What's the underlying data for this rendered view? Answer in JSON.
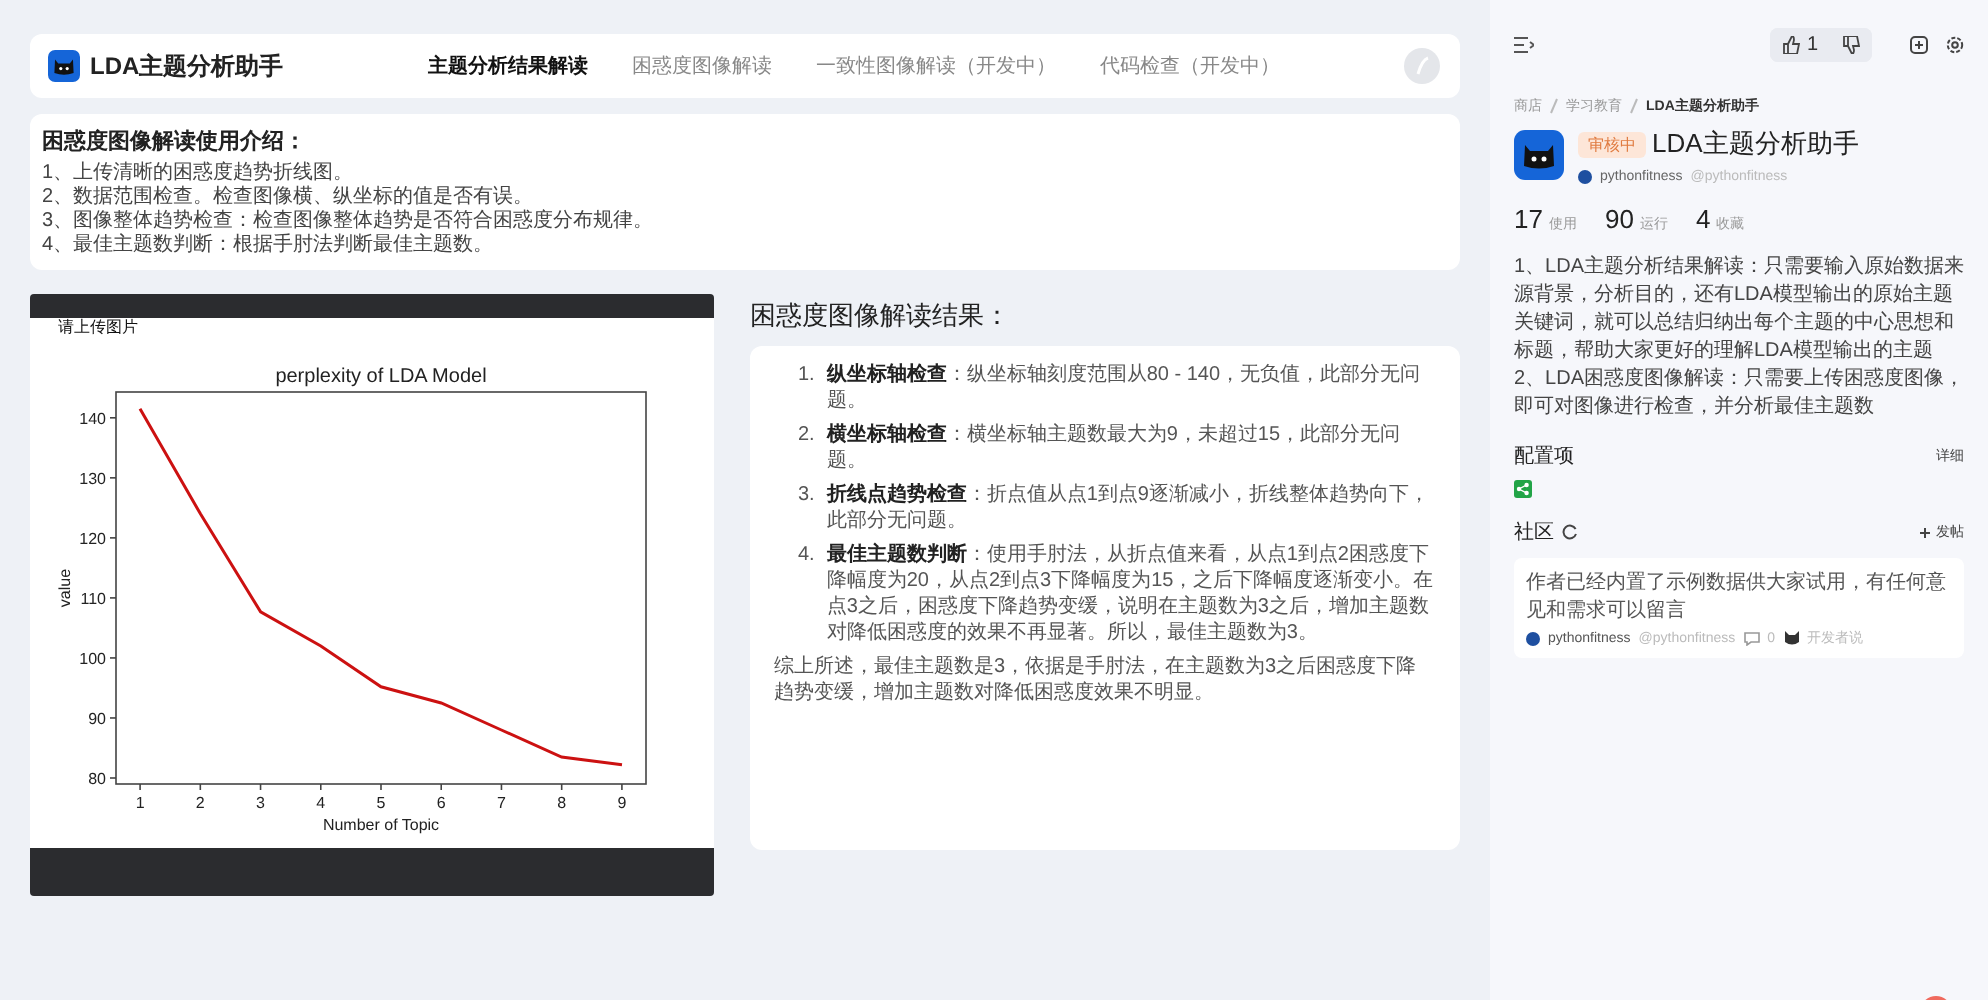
{
  "app": {
    "name": "LDA主题分析助手"
  },
  "nav_tabs": [
    {
      "label": "主题分析结果解读",
      "selected": true
    },
    {
      "label": "困惑度图像解读",
      "selected": false
    },
    {
      "label": "一致性图像解读（开发中）",
      "selected": false
    },
    {
      "label": "代码检查（开发中）",
      "selected": false
    }
  ],
  "intro": {
    "title": "困惑度图像解读使用介绍：",
    "items": [
      "1、上传清晰的困惑度趋势折线图。",
      "2、数据范围检查。检查图像横、纵坐标的值是否有误。",
      "3、图像整体趋势检查：检查图像整体趋势是否符合困惑度分布规律。",
      "4、最佳主题数判断：根据手肘法判断最佳主题数。"
    ]
  },
  "upload": {
    "label": "请上传图片",
    "chart_data": {
      "type": "line",
      "title": "perplexity of LDA Model",
      "xlabel": "Number of Topic",
      "ylabel": "value",
      "x": [
        1,
        2,
        3,
        4,
        5,
        6,
        7,
        8,
        9
      ],
      "series": [
        {
          "color": "#cc1111",
          "values": [
            141.5,
            124,
            107.7,
            102,
            95.2,
            92.5,
            88,
            83.5,
            82.2
          ]
        }
      ],
      "xlim": [
        0.6,
        9.4
      ],
      "ylim": [
        79,
        144.3
      ],
      "xticks": [
        1,
        2,
        3,
        4,
        5,
        6,
        7,
        8,
        9
      ],
      "yticks": [
        80,
        90,
        100,
        110,
        120,
        130,
        140
      ]
    }
  },
  "result": {
    "title": "困惑度图像解读结果：",
    "items": [
      {
        "number": "1.",
        "text": "**纵坐标轴检查**：纵坐标轴刻度范围从80 - 140，无负值，此部分无问题。"
      },
      {
        "number": "2.",
        "text": "**横坐标轴检查**：横坐标轴主题数最大为9，未超过15，此部分无问题。"
      },
      {
        "number": "3.",
        "text": "**折线点趋势检查**：折点值从点1到点9逐渐减小，折线整体趋势向下，此部分无问题。"
      },
      {
        "number": "4.",
        "text": "**最佳主题数判断**：使用手肘法，从折点值来看，从点1到点2困惑度下降幅度为20，从点2到点3下降幅度为15，之后下降幅度逐渐变小。在点3之后，困惑度下降趋势变缓，说明在主题数为3之后，增加主题数对降低困惑度的效果不再显著。所以，最佳主题数为3。"
      }
    ],
    "summary": "综上所述，最佳主题数是3，依据是手肘法，在主题数为3之后困惑度下降趋势变缓，增加主题数对降低困惑度效果不明显。"
  },
  "side": {
    "likes": "1",
    "breadcrumb": [
      "商店",
      "学习教育",
      "LDA主题分析助手"
    ],
    "status": "审核中",
    "title": "LDA主题分析助手",
    "author": "pythonfitness",
    "handle": "@pythonfitness",
    "stats": [
      {
        "value": "17",
        "label": "使用"
      },
      {
        "value": "90",
        "label": "运行"
      },
      {
        "value": "4",
        "label": "收藏"
      }
    ],
    "description": "1、LDA主题分析结果解读：只需要输入原始数据来源背景，分析目的，还有LDA模型输出的原始主题关键词，就可以总结归纳出每个主题的中心思想和标题，帮助大家更好的理解LDA模型输出的主题 2、LDA困惑度图像解读：只需要上传困惑度图像，即可对图像进行检查，并分析最佳主题数",
    "config": {
      "title": "配置项",
      "link": "详细"
    },
    "community": {
      "title": "社区",
      "post_button": "发帖",
      "posts": [
        {
          "text": "作者已经内置了示例数据供大家试用，有任何意见和需求可以留言",
          "author": "pythonfitness",
          "handle": "@pythonfitness",
          "comments": "0",
          "tag": "开发者说"
        }
      ]
    }
  }
}
